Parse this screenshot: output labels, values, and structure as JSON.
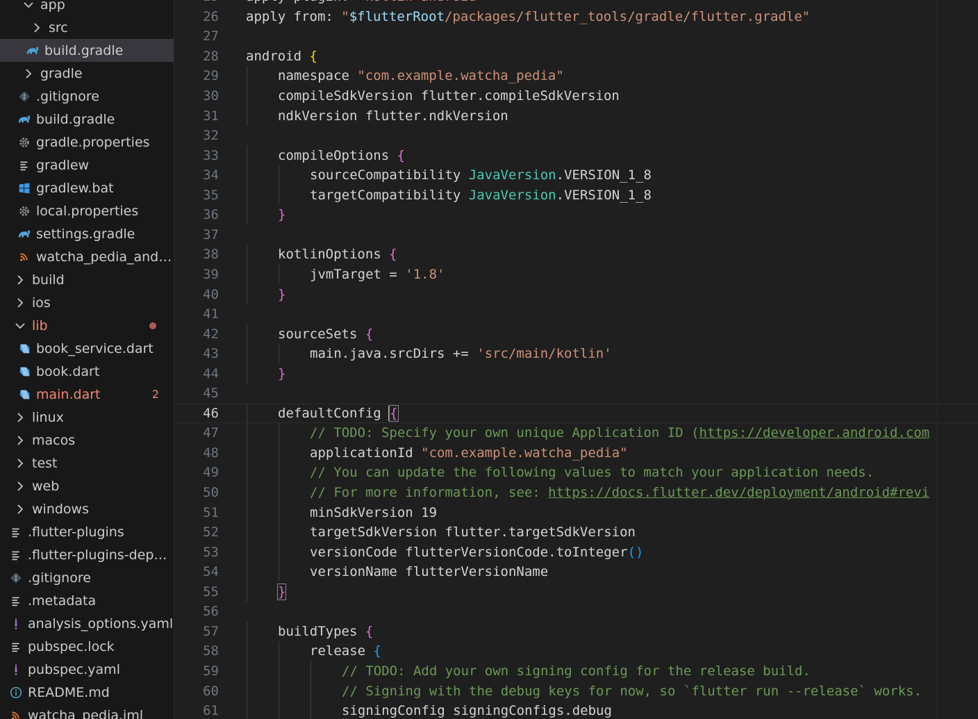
{
  "explorer": {
    "items": [
      {
        "label": "app",
        "type": "folder-open",
        "depth": 3
      },
      {
        "label": "src",
        "type": "folder",
        "depth": 4
      },
      {
        "label": "build.gradle",
        "type": "gradle",
        "depth": 3.5,
        "selected": true
      },
      {
        "label": "gradle",
        "type": "folder",
        "depth": 3
      },
      {
        "label": ".gitignore",
        "type": "git",
        "depth": 2.5
      },
      {
        "label": "build.gradle",
        "type": "gradle",
        "depth": 2.5
      },
      {
        "label": "gradle.properties",
        "type": "gear",
        "depth": 2.5
      },
      {
        "label": "gradlew",
        "type": "lines",
        "depth": 2.5
      },
      {
        "label": "gradlew.bat",
        "type": "windows",
        "depth": 2.5
      },
      {
        "label": "local.properties",
        "type": "gear",
        "depth": 2.5
      },
      {
        "label": "settings.gradle",
        "type": "gradle",
        "depth": 2.5
      },
      {
        "label": "watcha_pedia_andro...",
        "type": "rss",
        "depth": 2.5
      },
      {
        "label": "build",
        "type": "folder",
        "depth": 2
      },
      {
        "label": "ios",
        "type": "folder",
        "depth": 2
      },
      {
        "label": "lib",
        "type": "folder-open",
        "depth": 2,
        "modified": true,
        "dot": true
      },
      {
        "label": "book_service.dart",
        "type": "dart",
        "depth": 2.5
      },
      {
        "label": "book.dart",
        "type": "dart",
        "depth": 2.5
      },
      {
        "label": "main.dart",
        "type": "dart",
        "depth": 2.5,
        "modified": true,
        "badge": "2"
      },
      {
        "label": "linux",
        "type": "folder",
        "depth": 2
      },
      {
        "label": "macos",
        "type": "folder",
        "depth": 2
      },
      {
        "label": "test",
        "type": "folder",
        "depth": 2
      },
      {
        "label": "web",
        "type": "folder",
        "depth": 2
      },
      {
        "label": "windows",
        "type": "folder",
        "depth": 2
      },
      {
        "label": ".flutter-plugins",
        "type": "lines",
        "depth": 1.5
      },
      {
        "label": ".flutter-plugins-depe...",
        "type": "lines",
        "depth": 1.5
      },
      {
        "label": ".gitignore",
        "type": "git",
        "depth": 1.5
      },
      {
        "label": ".metadata",
        "type": "lines",
        "depth": 1.5
      },
      {
        "label": "analysis_options.yaml",
        "type": "exclaim",
        "depth": 1.5
      },
      {
        "label": "pubspec.lock",
        "type": "lines",
        "depth": 1.5
      },
      {
        "label": "pubspec.yaml",
        "type": "exclaim",
        "depth": 1.5
      },
      {
        "label": "README.md",
        "type": "info",
        "depth": 1.5
      },
      {
        "label": "watcha_pedia.iml",
        "type": "rss",
        "depth": 1.5
      }
    ]
  },
  "editor": {
    "current_line": 46,
    "lines": [
      {
        "n": "25",
        "indent": 0,
        "tokens": [
          [
            "plain",
            "apply plugin: "
          ],
          [
            "string",
            "'kotlin-android'"
          ]
        ]
      },
      {
        "n": "26",
        "indent": 0,
        "tokens": [
          [
            "plain",
            "apply from: "
          ],
          [
            "string",
            "\""
          ],
          [
            "var",
            "$flutterRoot"
          ],
          [
            "string",
            "/packages/flutter_tools/gradle/flutter.gradle\""
          ]
        ]
      },
      {
        "n": "27",
        "indent": 0,
        "tokens": []
      },
      {
        "n": "28",
        "indent": 0,
        "tokens": [
          [
            "plain",
            "android "
          ],
          [
            "b1",
            "{"
          ]
        ]
      },
      {
        "n": "29",
        "indent": 1,
        "tokens": [
          [
            "plain",
            "namespace "
          ],
          [
            "string",
            "\"com.example.watcha_pedia\""
          ]
        ]
      },
      {
        "n": "30",
        "indent": 1,
        "tokens": [
          [
            "plain",
            "compileSdkVersion flutter.compileSdkVersion"
          ]
        ]
      },
      {
        "n": "31",
        "indent": 1,
        "tokens": [
          [
            "plain",
            "ndkVersion flutter.ndkVersion"
          ]
        ]
      },
      {
        "n": "32",
        "indent": 0,
        "tokens": []
      },
      {
        "n": "33",
        "indent": 1,
        "tokens": [
          [
            "plain",
            "compileOptions "
          ],
          [
            "b2",
            "{"
          ]
        ]
      },
      {
        "n": "34",
        "indent": 2,
        "tokens": [
          [
            "plain",
            "sourceCompatibility "
          ],
          [
            "class",
            "JavaVersion"
          ],
          [
            "plain",
            ".VERSION_1_8"
          ]
        ]
      },
      {
        "n": "35",
        "indent": 2,
        "tokens": [
          [
            "plain",
            "targetCompatibility "
          ],
          [
            "class",
            "JavaVersion"
          ],
          [
            "plain",
            ".VERSION_1_8"
          ]
        ]
      },
      {
        "n": "36",
        "indent": 1,
        "tokens": [
          [
            "b2",
            "}"
          ]
        ]
      },
      {
        "n": "37",
        "indent": 0,
        "tokens": []
      },
      {
        "n": "38",
        "indent": 1,
        "tokens": [
          [
            "plain",
            "kotlinOptions "
          ],
          [
            "b2",
            "{"
          ]
        ]
      },
      {
        "n": "39",
        "indent": 2,
        "tokens": [
          [
            "plain",
            "jvmTarget = "
          ],
          [
            "string",
            "'1.8'"
          ]
        ]
      },
      {
        "n": "40",
        "indent": 1,
        "tokens": [
          [
            "b2",
            "}"
          ]
        ]
      },
      {
        "n": "41",
        "indent": 0,
        "tokens": []
      },
      {
        "n": "42",
        "indent": 1,
        "tokens": [
          [
            "plain",
            "sourceSets "
          ],
          [
            "b2",
            "{"
          ]
        ]
      },
      {
        "n": "43",
        "indent": 2,
        "tokens": [
          [
            "plain",
            "main.java.srcDirs += "
          ],
          [
            "string",
            "'src/main/kotlin'"
          ]
        ]
      },
      {
        "n": "44",
        "indent": 1,
        "tokens": [
          [
            "b2",
            "}"
          ]
        ]
      },
      {
        "n": "45",
        "indent": 0,
        "tokens": []
      },
      {
        "n": "46",
        "indent": 1,
        "tokens": [
          [
            "plain",
            "defaultConfig "
          ],
          [
            "b2m",
            "{"
          ]
        ]
      },
      {
        "n": "47",
        "indent": 2,
        "tokens": [
          [
            "comment",
            "// TODO: Specify your own unique Application ID ("
          ],
          [
            "link",
            "https://developer.android.com"
          ]
        ]
      },
      {
        "n": "48",
        "indent": 2,
        "tokens": [
          [
            "plain",
            "applicationId "
          ],
          [
            "string",
            "\"com.example.watcha_pedia\""
          ]
        ]
      },
      {
        "n": "49",
        "indent": 2,
        "tokens": [
          [
            "comment",
            "// You can update the following values to match your application needs."
          ]
        ]
      },
      {
        "n": "50",
        "indent": 2,
        "tokens": [
          [
            "comment",
            "// For more information, see: "
          ],
          [
            "link",
            "https://docs.flutter.dev/deployment/android#revi"
          ]
        ]
      },
      {
        "n": "51",
        "indent": 2,
        "tokens": [
          [
            "plain",
            "minSdkVersion 19"
          ]
        ]
      },
      {
        "n": "52",
        "indent": 2,
        "tokens": [
          [
            "plain",
            "targetSdkVersion flutter.targetSdkVersion"
          ]
        ]
      },
      {
        "n": "53",
        "indent": 2,
        "tokens": [
          [
            "plain",
            "versionCode flutterVersionCode.toInteger"
          ],
          [
            "b3",
            "()"
          ]
        ]
      },
      {
        "n": "54",
        "indent": 2,
        "tokens": [
          [
            "plain",
            "versionName flutterVersionName"
          ]
        ]
      },
      {
        "n": "55",
        "indent": 1,
        "tokens": [
          [
            "b2m",
            "}"
          ]
        ]
      },
      {
        "n": "56",
        "indent": 0,
        "tokens": []
      },
      {
        "n": "57",
        "indent": 1,
        "tokens": [
          [
            "plain",
            "buildTypes "
          ],
          [
            "b2",
            "{"
          ]
        ]
      },
      {
        "n": "58",
        "indent": 2,
        "tokens": [
          [
            "plain",
            "release "
          ],
          [
            "b3",
            "{"
          ]
        ]
      },
      {
        "n": "59",
        "indent": 3,
        "tokens": [
          [
            "comment",
            "// TODO: Add your own signing config for the release build."
          ]
        ]
      },
      {
        "n": "60",
        "indent": 3,
        "tokens": [
          [
            "comment",
            "// Signing with the debug keys for now, so `flutter run --release` works."
          ]
        ]
      },
      {
        "n": "61",
        "indent": 3,
        "tokens": [
          [
            "plain",
            "signingConfig signingConfigs.debug"
          ]
        ]
      }
    ]
  }
}
